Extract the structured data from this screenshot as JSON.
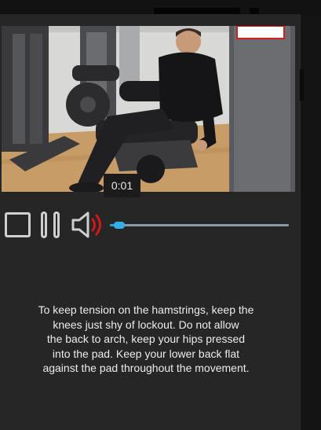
{
  "player": {
    "current_time": "0:01",
    "progress_fraction": 0.04,
    "controls": {
      "stop": "stop-icon",
      "pause": "pause-icon",
      "volume": "volume-icon"
    },
    "colors": {
      "accent": "#2aa0d6",
      "track": "#8a9aa4",
      "volume_wave": "#d01818",
      "icon": "#cfcfcf"
    }
  },
  "exercise": {
    "instructions": "To keep tension on the hamstrings, keep the\nknees just shy of lockout. Do not allow\nthe back to arch, keep your hips pressed\ninto the pad. Keep your lower back flat\nagainst the pad throughout the movement."
  }
}
